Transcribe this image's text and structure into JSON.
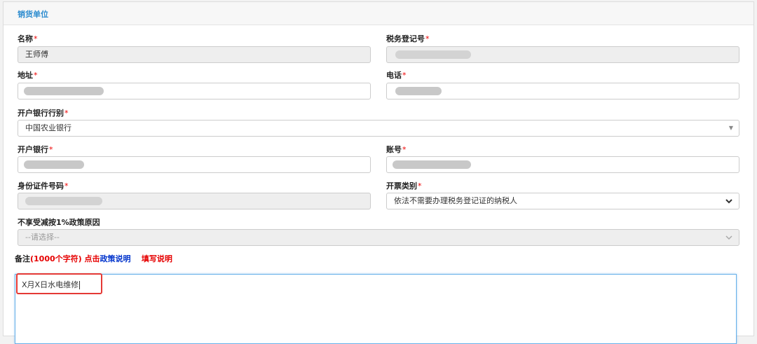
{
  "panel": {
    "title": "销货单位"
  },
  "required_mark": "*",
  "fields": {
    "name": {
      "label": "名称",
      "value": "王师傅"
    },
    "tax_reg_no": {
      "label": "税务登记号",
      "value": ""
    },
    "address": {
      "label": "地址",
      "value": ""
    },
    "phone": {
      "label": "电话",
      "value": ""
    },
    "bank_type": {
      "label": "开户银行行别",
      "value": "中国农业银行"
    },
    "bank": {
      "label": "开户银行",
      "value": ""
    },
    "account": {
      "label": "账号",
      "value": ""
    },
    "id_number": {
      "label": "身份证件号码",
      "value": ""
    },
    "invoice_type": {
      "label": "开票类别",
      "value": "依法不需要办理税务登记证的纳税人"
    },
    "reduction_reason": {
      "label": "不享受减按1%政策原因",
      "placeholder": "--请选择--"
    }
  },
  "note": {
    "prefix": "备注",
    "limit": "(1000个字符) 点击",
    "policy_link": "政策说明",
    "fill_link": "填写说明",
    "value": "X月X日水电维修"
  },
  "colors": {
    "accent": "#2d8ccf",
    "required": "#e60000",
    "link_blue": "#0033cc",
    "highlight": "#e53935"
  }
}
